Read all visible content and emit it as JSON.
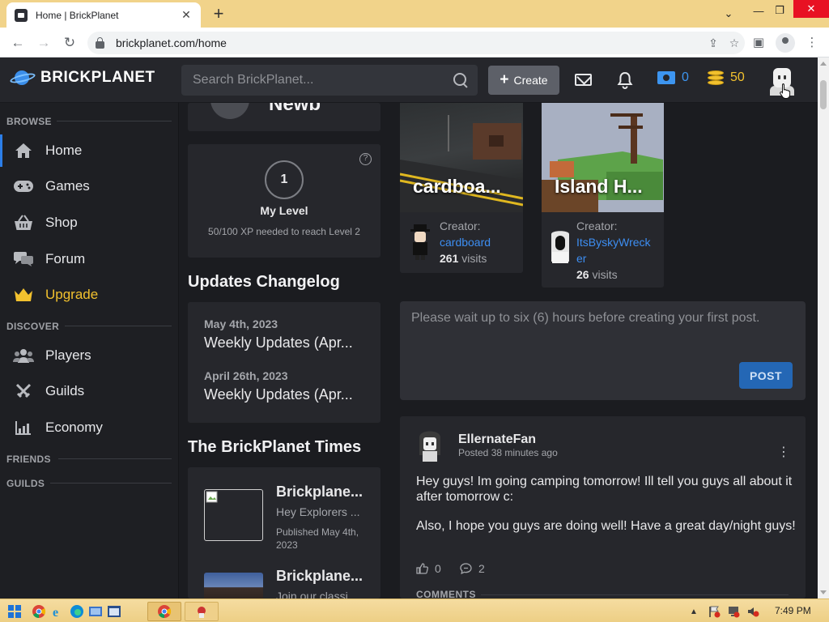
{
  "browser": {
    "tab_title": "Home | BrickPlanet",
    "tab_close": "✕",
    "new_tab": "+",
    "url": "brickplanet.com/home",
    "window": {
      "minimize": "—",
      "maximize": "❐",
      "close": "✕"
    }
  },
  "header": {
    "logo_text": "BRICKPLANET",
    "search_placeholder": "Search BrickPlanet...",
    "create_label": "Create",
    "bucks": "0",
    "bits": "50"
  },
  "sidebar": {
    "browse_title": "BROWSE",
    "browse": [
      {
        "label": "Home",
        "icon": "home-icon"
      },
      {
        "label": "Games",
        "icon": "gamepad-icon"
      },
      {
        "label": "Shop",
        "icon": "basket-icon"
      },
      {
        "label": "Forum",
        "icon": "chat-icon"
      },
      {
        "label": "Upgrade",
        "icon": "crown-icon"
      }
    ],
    "discover_title": "DISCOVER",
    "discover": [
      {
        "label": "Players",
        "icon": "users-icon"
      },
      {
        "label": "Guilds",
        "icon": "swords-icon"
      },
      {
        "label": "Economy",
        "icon": "chart-icon"
      }
    ],
    "friends_title": "FRIENDS",
    "guilds_title": "GUILDS"
  },
  "profile": {
    "rank": "Newb"
  },
  "level": {
    "number": "1",
    "title": "My Level",
    "progress_text": "50/100 XP needed to reach Level 2"
  },
  "changelog": {
    "title": "Updates Changelog",
    "entries": [
      {
        "date": "May 4th, 2023",
        "title": "Weekly Updates (Apr..."
      },
      {
        "date": "April 26th, 2023",
        "title": "Weekly Updates (Apr..."
      }
    ]
  },
  "times": {
    "title": "The BrickPlanet Times",
    "articles": [
      {
        "title": "Brickplane...",
        "excerpt": "Hey Explorers ...",
        "published": "Published May 4th,",
        "published_year": "2023"
      },
      {
        "title": "Brickplane...",
        "excerpt": "Join our classi..."
      }
    ]
  },
  "games": [
    {
      "title": "cardboa...",
      "creator_label": "Creator:",
      "creator": "cardboard",
      "visits": "261",
      "visits_label": "visits"
    },
    {
      "title": "Island H...",
      "creator_label": "Creator:",
      "creator_line1": "ItsByskyWreck",
      "creator_line2": "er",
      "visits": "26",
      "visits_label": "visits"
    }
  ],
  "composer": {
    "placeholder": "Please wait up to six (6) hours before creating your first post.",
    "post_label": "POST"
  },
  "feed": {
    "post": {
      "author": "EllernateFan",
      "time": "Posted 38 minutes ago",
      "body1": "Hey guys! Im going camping tomorrow! Ill tell you guys all about it after tomorrow c:",
      "body2": "Also, I hope you guys are doing well! Have a great day/night guys!",
      "likes": "0",
      "comments": "2",
      "comments_heading": "COMMENTS"
    }
  },
  "taskbar": {
    "time": "7:49 PM"
  },
  "colors": {
    "accent": "#2c7ee8",
    "bucks": "#3d95f0",
    "bits": "#f2c12e",
    "background": "#1b1c20",
    "card": "#26272c"
  }
}
